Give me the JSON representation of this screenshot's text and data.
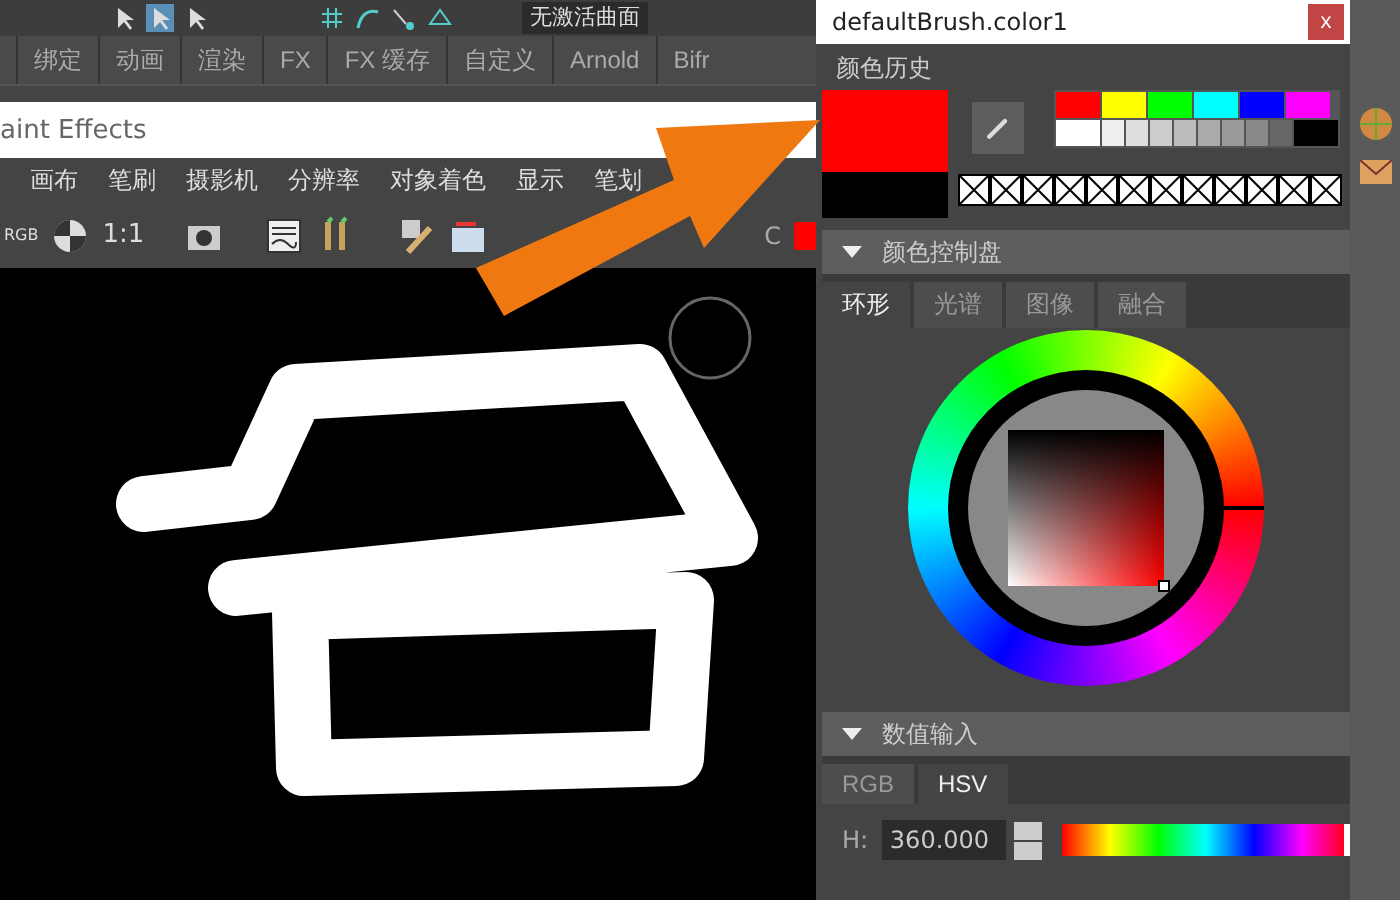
{
  "top_toolbar": {
    "field": "无激活曲面"
  },
  "shelf_tabs": [
    {
      "label": "绑定"
    },
    {
      "label": "动画"
    },
    {
      "label": "渲染"
    },
    {
      "label": "FX"
    },
    {
      "label": "FX 缓存"
    },
    {
      "label": "自定义"
    },
    {
      "label": "Arnold"
    },
    {
      "label": "Bifr"
    }
  ],
  "panel": {
    "title": "aint Effects",
    "menus": [
      "画布",
      "笔刷",
      "摄影机",
      "分辨率",
      "对象着色",
      "显示",
      "笔划"
    ],
    "toolbar": {
      "rgb": "RGB",
      "ratio": "1:1",
      "color_label": "C",
      "color": "#ff0000"
    }
  },
  "dialog": {
    "title": "defaultBrush.color1",
    "close": "x",
    "history_label": "颜色历史",
    "history": [
      {
        "color": "#ff0000"
      },
      {
        "color": "#000000"
      }
    ],
    "palette": [
      {
        "color": "#ff0000"
      },
      {
        "color": "#ffff00"
      },
      {
        "color": "#00ff00"
      },
      {
        "color": "#00ffff"
      },
      {
        "color": "#0000ff"
      },
      {
        "color": "#ff00ff"
      }
    ],
    "grays": [
      {
        "color": "#ffffff"
      },
      {
        "color": "#eeeeee"
      },
      {
        "color": "#dddddd"
      },
      {
        "color": "#cccccc"
      },
      {
        "color": "#bbbbbb"
      },
      {
        "color": "#aaaaaa"
      },
      {
        "color": "#999999"
      },
      {
        "color": "#888888"
      },
      {
        "color": "#666666"
      },
      {
        "color": "#000000"
      }
    ],
    "wheel_section": {
      "title": "颜色控制盘",
      "expanded": true,
      "tabs": [
        {
          "label": "环形",
          "selected": true
        },
        {
          "label": "光谱",
          "selected": false
        },
        {
          "label": "图像",
          "selected": false
        },
        {
          "label": "融合",
          "selected": false
        }
      ]
    },
    "value_section": {
      "title": "数值输入",
      "expanded": true,
      "tabs": [
        {
          "label": "RGB",
          "selected": false
        },
        {
          "label": "HSV",
          "selected": true
        }
      ],
      "rows": [
        {
          "label": "H:",
          "value": "360.000",
          "level": 1
        }
      ]
    }
  }
}
